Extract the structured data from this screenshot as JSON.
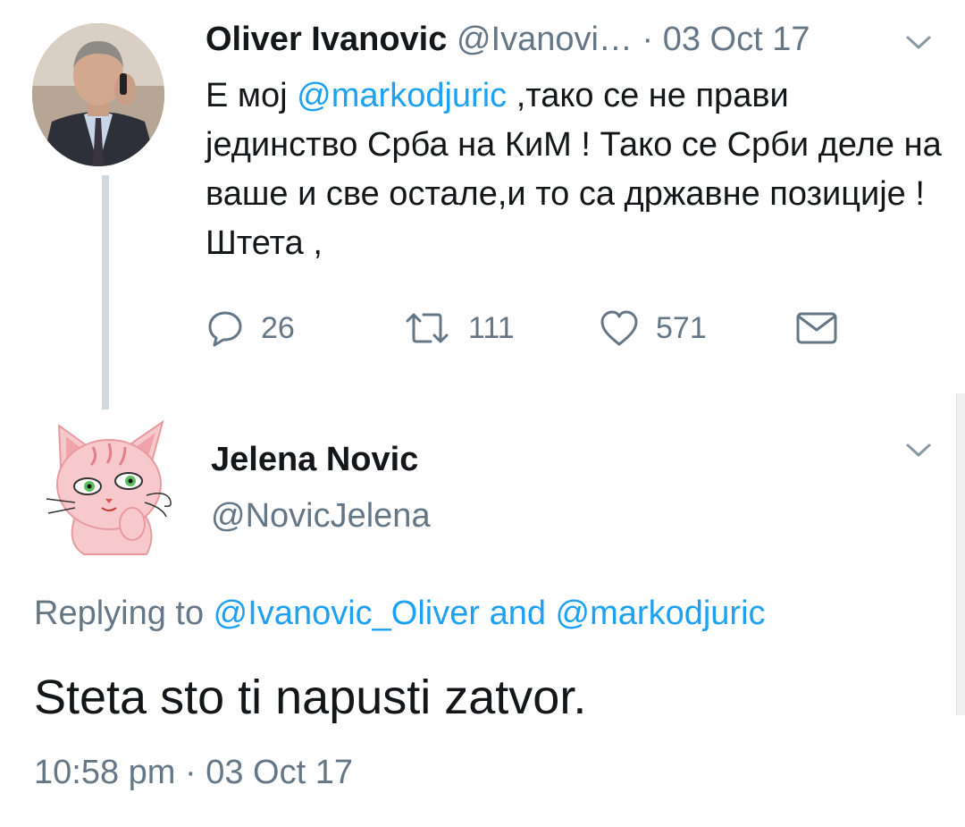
{
  "original_tweet": {
    "author_name": "Oliver Ivanovic",
    "author_handle": "@Ivanovi…",
    "separator": "·",
    "date": "03 Oct 17",
    "text_before_mention": "Е мој ",
    "mention": "@markodjuric",
    "text_after_mention": " ,тако се не прави јединство Срба на КиМ ! Тако се Срби деле на ваше и све остале,и то са државне позиције ! Штета ,",
    "actions": {
      "reply_icon": "reply-bubble-icon",
      "reply_count": "26",
      "retweet_icon": "retweet-icon",
      "retweet_count": "111",
      "like_icon": "heart-icon",
      "like_count": "571",
      "dm_icon": "envelope-icon"
    }
  },
  "reply_tweet": {
    "author_name": "Jelena Novic",
    "author_handle": "@NovicJelena",
    "replying_prefix": "Replying to ",
    "replying_to_1": "@Ivanovic_Oliver",
    "replying_and": " and ",
    "replying_to_2": "@markodjuric",
    "text": "Steta sto ti napusti zatvor.",
    "time": "10:58 pm",
    "separator": "·",
    "date": "03 Oct 17"
  },
  "colors": {
    "link": "#1da1f2",
    "secondary_text": "#657786",
    "primary_text": "#14171a",
    "thread_line": "#cfd9de"
  }
}
